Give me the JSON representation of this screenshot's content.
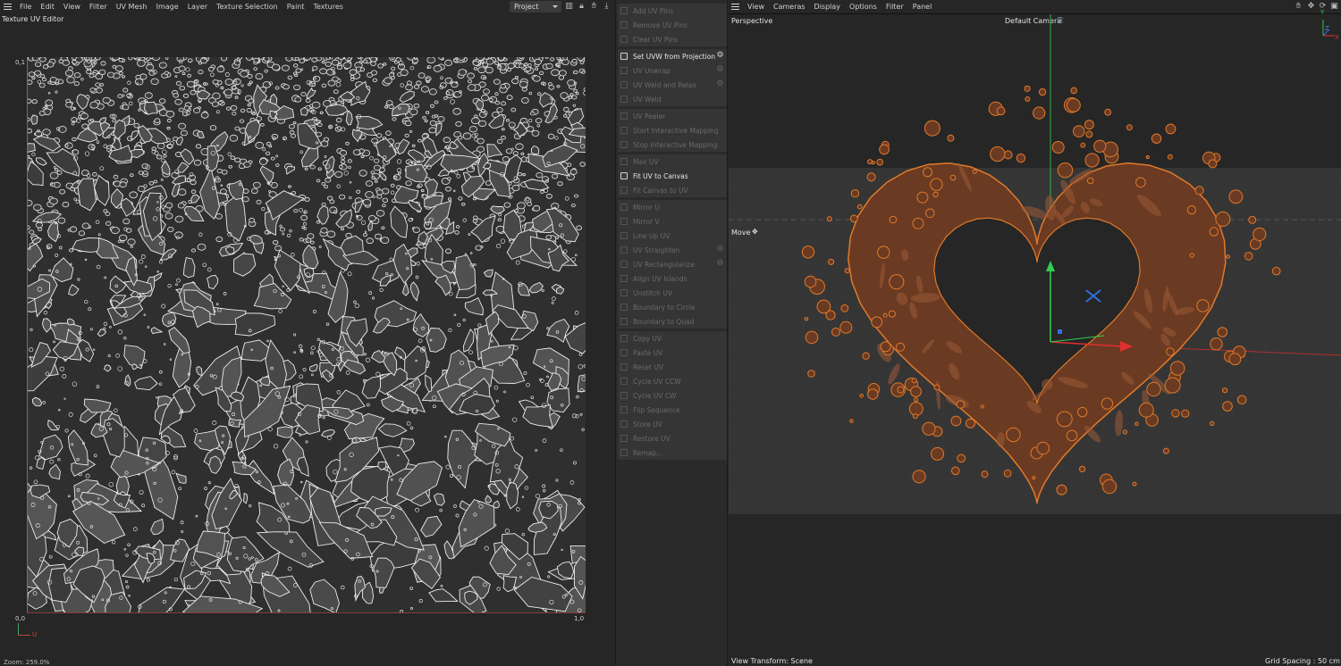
{
  "uv_editor": {
    "menu": [
      "File",
      "Edit",
      "View",
      "Filter",
      "UV Mesh",
      "Image",
      "Layer",
      "Texture Selection",
      "Paint",
      "Textures"
    ],
    "project_select": "Project",
    "panel_title": "Texture UV Editor",
    "coords": {
      "top_left": "0,1",
      "bottom_left": "0,0",
      "bottom_right": "1,0"
    },
    "axis_label": "U",
    "zoom": "Zoom: 259.0%",
    "icons": [
      "histogram-icon",
      "lock-icon",
      "hand-icon",
      "download-icon"
    ]
  },
  "commands": {
    "groups": [
      [
        {
          "label": "Add UV Pins",
          "enabled": false,
          "gear": false
        },
        {
          "label": "Remove UV Pins",
          "enabled": false,
          "gear": false
        },
        {
          "label": "Clear UV Pins",
          "enabled": false,
          "gear": false
        }
      ],
      [
        {
          "label": "Set UVW from Projection",
          "enabled": true,
          "gear": true
        },
        {
          "label": "UV Unwrap",
          "enabled": false,
          "gear": true
        },
        {
          "label": "UV Weld and Relax",
          "enabled": false,
          "gear": true
        },
        {
          "label": "UV Weld",
          "enabled": false,
          "gear": false
        }
      ],
      [
        {
          "label": "UV Peeler",
          "enabled": false,
          "gear": false
        },
        {
          "label": "Start Interactive Mapping",
          "enabled": false,
          "gear": false
        },
        {
          "label": "Stop Interactive Mapping",
          "enabled": false,
          "gear": false
        }
      ],
      [
        {
          "label": "Max UV",
          "enabled": false,
          "gear": false
        },
        {
          "label": "Fit UV to Canvas",
          "enabled": true,
          "gear": false
        },
        {
          "label": "Fit Canvas to UV",
          "enabled": false,
          "gear": false
        }
      ],
      [
        {
          "label": "Mirror U",
          "enabled": false,
          "gear": false
        },
        {
          "label": "Mirror V",
          "enabled": false,
          "gear": false
        },
        {
          "label": "Line Up UV",
          "enabled": false,
          "gear": false
        },
        {
          "label": "UV Straighten",
          "enabled": false,
          "gear": true
        },
        {
          "label": "UV Rectangularize",
          "enabled": false,
          "gear": true
        },
        {
          "label": "Align UV Islands",
          "enabled": false,
          "gear": false
        },
        {
          "label": "Unstitch UV",
          "enabled": false,
          "gear": false
        },
        {
          "label": "Boundary to Circle",
          "enabled": false,
          "gear": false
        },
        {
          "label": "Boundary to Quad",
          "enabled": false,
          "gear": false
        }
      ],
      [
        {
          "label": "Copy UV",
          "enabled": false,
          "gear": false
        },
        {
          "label": "Paste UV",
          "enabled": false,
          "gear": false
        },
        {
          "label": "Reset UV",
          "enabled": false,
          "gear": false
        },
        {
          "label": "Cycle UV CCW",
          "enabled": false,
          "gear": false
        },
        {
          "label": "Cycle UV CW",
          "enabled": false,
          "gear": false
        },
        {
          "label": "Flip Sequence",
          "enabled": false,
          "gear": false
        },
        {
          "label": "Store UV",
          "enabled": false,
          "gear": false
        },
        {
          "label": "Restore UV",
          "enabled": false,
          "gear": false
        },
        {
          "label": "Remap...",
          "enabled": false,
          "gear": false
        }
      ]
    ]
  },
  "viewport": {
    "menu": [
      "View",
      "Cameras",
      "Display",
      "Options",
      "Filter",
      "Panel"
    ],
    "projection": "Perspective",
    "camera": "Default Camera",
    "tool": "Move",
    "view_transform": "View Transform: Scene",
    "grid_spacing": "Grid Spacing : 50 cm",
    "axis_labels": {
      "y": "Y",
      "z": "Z",
      "x": "X"
    },
    "colors": {
      "x_axis": "#e03030",
      "y_axis": "#30c050",
      "z_axis": "#3070e0",
      "chocolate": "#6b3a22",
      "outline": "#e07a2a"
    }
  }
}
